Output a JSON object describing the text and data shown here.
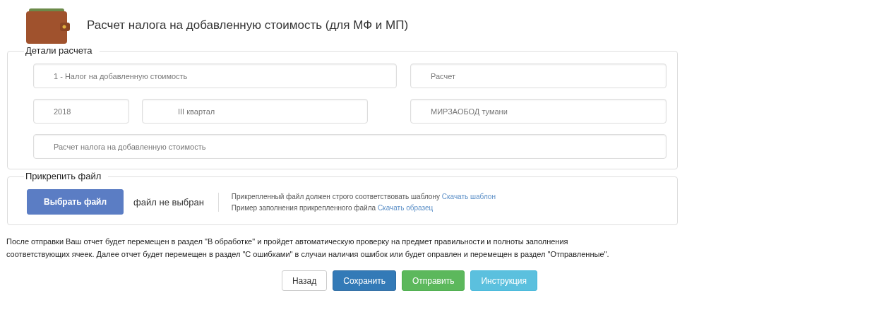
{
  "header": {
    "title": "Расчет налога на добавленную стоимость (для МФ и МП)"
  },
  "details": {
    "legend": "Детали расчета",
    "tax_type": "1 - Налог на добавленную стоимость",
    "report_type": "Расчет",
    "year": "2018",
    "period": "III квартал",
    "district": "МИРЗАОБОД тумани",
    "description": "Расчет налога на добавленную стоимость"
  },
  "attach": {
    "legend": "Прикрепить файл",
    "choose_button": "Выбрать файл",
    "file_status": "файл не выбран",
    "notes": [
      {
        "text": "Прикрепленный файл должен строго соответствовать шаблону",
        "link": "Скачать шаблон"
      },
      {
        "text": "Пример заполнения прикрепленного файла",
        "link": "Скачать образец"
      }
    ]
  },
  "notice": [
    "После отправки Ваш отчет будет перемещен в раздел \"В обработке\" и пройдет автоматическую проверку на предмет правильности и полноты заполнения",
    "соответствующих ячеек. Далее отчет будет перемещен в раздел \"С ошибками\" в случаи наличия ошибок или будет оправлен и перемещен в раздел \"Отправленные\"."
  ],
  "buttons": [
    {
      "label": "Назад",
      "kind": "default"
    },
    {
      "label": "Сохранить",
      "kind": "primary"
    },
    {
      "label": "Отправить",
      "kind": "success"
    },
    {
      "label": "Инструкция",
      "kind": "info"
    }
  ]
}
